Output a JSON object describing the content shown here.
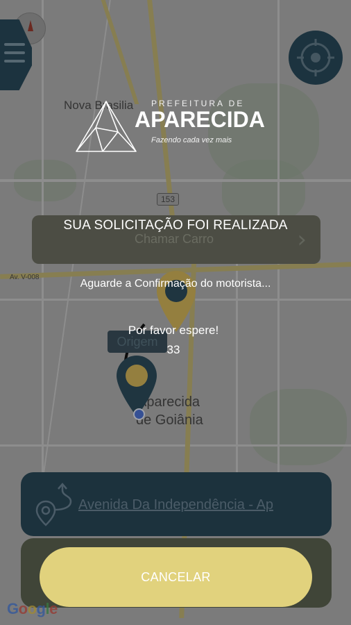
{
  "map": {
    "labels": {
      "nova_brasilia": "Nova Brasilia",
      "route_153": "153",
      "av_v008": "Av. V-008",
      "aparecida_line1": "Aparecida",
      "aparecida_line2": "de Goiânia"
    }
  },
  "logo": {
    "prefix": "PREFEITURA DE",
    "city": "APARECIDA",
    "tagline": "Fazendo cada vez mais"
  },
  "chamar": {
    "label": "Chamar Carro"
  },
  "origin_label": "Origem",
  "destination": {
    "address": "Avenida Da Independência - Ap"
  },
  "dialog": {
    "title": "SUA SOLICITAÇÃO FOI REALIZADA",
    "message": "Aguarde a Confirmação do motorista...",
    "wait": "Por favor espere!",
    "countdown": "33"
  },
  "cancel_button": "CANCELAR",
  "google": "Google",
  "colors": {
    "navy": "#173748",
    "gold": "#e1d27d",
    "pin_gold": "#c7a84a"
  }
}
